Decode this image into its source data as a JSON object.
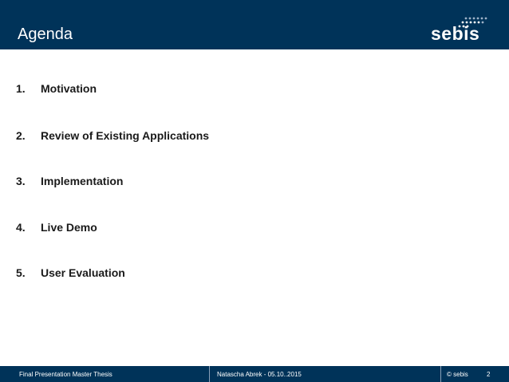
{
  "header": {
    "title": "Agenda",
    "logo_text": "sebis"
  },
  "agenda": {
    "items": [
      {
        "number": "1.",
        "label": "Motivation"
      },
      {
        "number": "2.",
        "label": "Review of Existing Applications"
      },
      {
        "number": "3.",
        "label": "Implementation"
      },
      {
        "number": "4.",
        "label": "Live Demo"
      },
      {
        "number": "5.",
        "label": "User Evaluation"
      }
    ]
  },
  "footer": {
    "presentation": "Final Presentation Master Thesis",
    "author_date": "Natascha Abrek  -  05.10..2015",
    "copyright": "© sebis",
    "page_number": "2"
  },
  "colors": {
    "header_bg": "#003359",
    "footer_bg": "#003359",
    "text": "#1a1a1a"
  }
}
